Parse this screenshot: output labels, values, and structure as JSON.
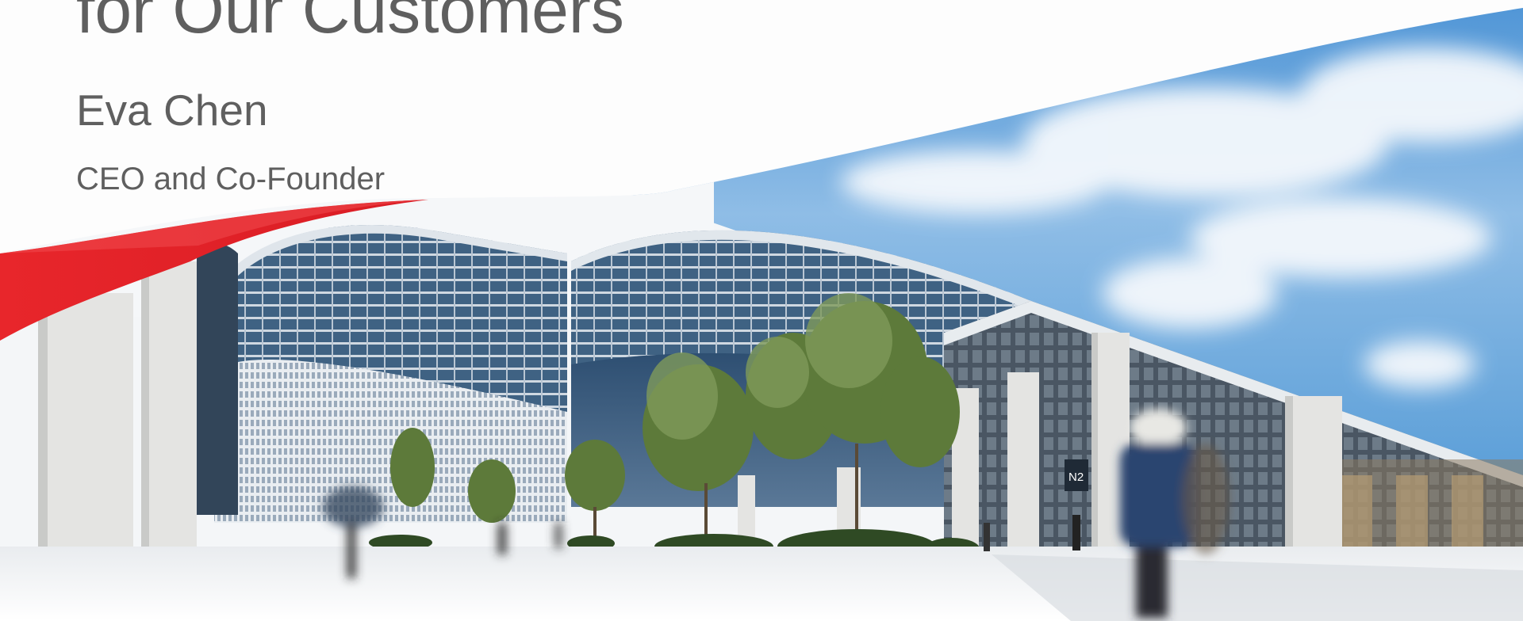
{
  "slide": {
    "title_line": "for Our Customers",
    "presenter_name": "Eva Chen",
    "presenter_role": "CEO and Co-Founder"
  },
  "photo": {
    "subject": "modern-office-building",
    "signage": [
      "N2"
    ]
  },
  "colors": {
    "text": "#5f5f5f",
    "accent_red": "#e52b2e",
    "sky_blue": "#6aa6d8",
    "background": "#fdfdfd"
  }
}
